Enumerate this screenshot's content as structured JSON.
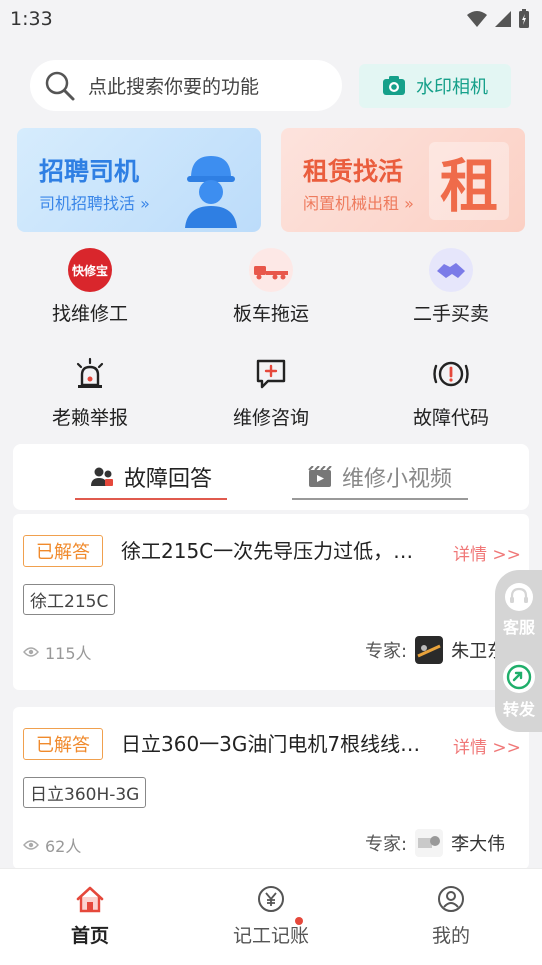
{
  "status_bar": {
    "time": "1:33"
  },
  "search": {
    "placeholder": "点此搜索你要的功能"
  },
  "watermark_camera": {
    "label": "水印相机"
  },
  "banners": [
    {
      "title": "招聘司机",
      "subtitle": "司机招聘找活 »"
    },
    {
      "title": "租赁找活",
      "subtitle": "闲置机械出租 »",
      "badge": "租"
    }
  ],
  "services": [
    {
      "label": "找维修工",
      "icon": "kuaixiubao-logo",
      "logo_text": "快修宝"
    },
    {
      "label": "板车拖运",
      "icon": "flatbed-truck-icon"
    },
    {
      "label": "二手买卖",
      "icon": "handshake-icon"
    },
    {
      "label": "老赖举报",
      "icon": "alarm-light-icon"
    },
    {
      "label": "维修咨询",
      "icon": "chat-plus-icon"
    },
    {
      "label": "故障代码",
      "icon": "fault-alert-icon"
    }
  ],
  "qa_tabs": [
    {
      "label": "故障回答",
      "active": true
    },
    {
      "label": "维修小视频",
      "active": false
    }
  ],
  "questions": [
    {
      "badge": "已解答",
      "title": "徐工215C一次先导压力过低，…",
      "detail": "详情 >>",
      "tag": "徐工215C",
      "views": "115人",
      "expert_label": "专家:",
      "expert_name": "朱卫东"
    },
    {
      "badge": "已解答",
      "title": "日立360一3G油门电机7根线线…",
      "detail": "详情 >>",
      "tag": "日立360H-3G",
      "views": "62人",
      "expert_label": "专家:",
      "expert_name": "李大伟"
    }
  ],
  "float_panel": {
    "service_label": "客服",
    "share_label": "转发"
  },
  "tabbar": [
    {
      "label": "首页",
      "active": true
    },
    {
      "label": "记工记账",
      "active": false,
      "has_dot": true
    },
    {
      "label": "我的",
      "active": false
    }
  ],
  "colors": {
    "accent_red": "#e05a4e",
    "teal": "#16a08a",
    "blue": "#2f7fe3",
    "orange": "#f08a2c"
  }
}
